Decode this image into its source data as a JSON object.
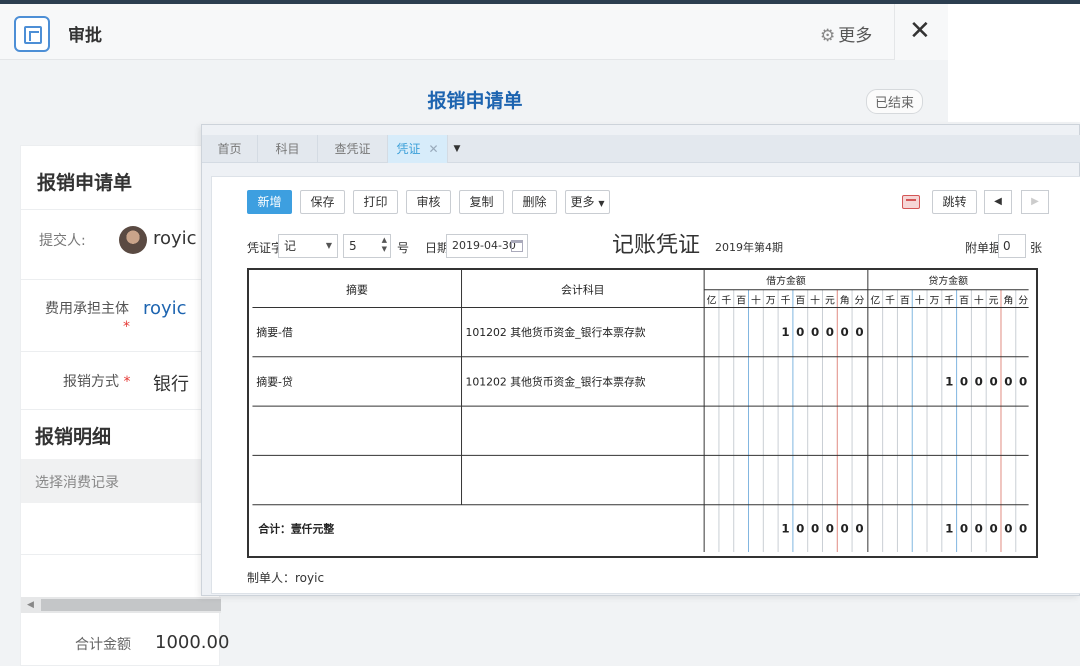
{
  "approval": {
    "title": "审批",
    "more_label": "更多",
    "close_label": "✕",
    "form_title": "报销申请单",
    "status": "已结束",
    "section_title": "报销申请单",
    "submitter_label": "提交人:",
    "submitter_name": "royic",
    "cost_owner_label": "费用承担主体",
    "cost_owner_value": "royic",
    "method_label": "报销方式",
    "method_value": "银行",
    "detail_title": "报销明细",
    "select_records": "选择消费记录",
    "total_label": "合计金额",
    "total_value": "1000.00",
    "required_mark": "*"
  },
  "voucher": {
    "tabs": [
      {
        "label": "首页"
      },
      {
        "label": "科目"
      },
      {
        "label": "查凭证"
      },
      {
        "label": "凭证",
        "active": true
      }
    ],
    "toolbar": {
      "add": "新增",
      "save": "保存",
      "print": "打印",
      "audit": "审核",
      "copy": "复制",
      "delete": "删除",
      "more": "更多",
      "jump": "跳转"
    },
    "word_label": "凭证字",
    "word_value": "记",
    "number_value": "5",
    "number_suffix": "号",
    "date_label": "日期",
    "date_value": "2019-04-30",
    "title": "记账凭证",
    "period": "2019年第4期",
    "attach_label": "附单据",
    "attach_value": "0",
    "attach_unit": "张",
    "columns": {
      "summary": "摘要",
      "account": "会计科目",
      "debit": "借方金额",
      "credit": "贷方金额"
    },
    "digit_units": [
      "亿",
      "千",
      "百",
      "十",
      "万",
      "千",
      "百",
      "十",
      "元",
      "角",
      "分"
    ],
    "rows": [
      {
        "summary": "摘要-借",
        "account": "101202 其他货币资金_银行本票存款",
        "debit": "100000",
        "credit": ""
      },
      {
        "summary": "摘要-贷",
        "account": "101202 其他货币资金_银行本票存款",
        "debit": "",
        "credit": "100000"
      },
      {
        "summary": "",
        "account": "",
        "debit": "",
        "credit": ""
      },
      {
        "summary": "",
        "account": "",
        "debit": "",
        "credit": ""
      }
    ],
    "total_label": "合计：壹仟元整",
    "total_debit": "100000",
    "total_credit": "100000",
    "maker": "制单人：royic"
  }
}
